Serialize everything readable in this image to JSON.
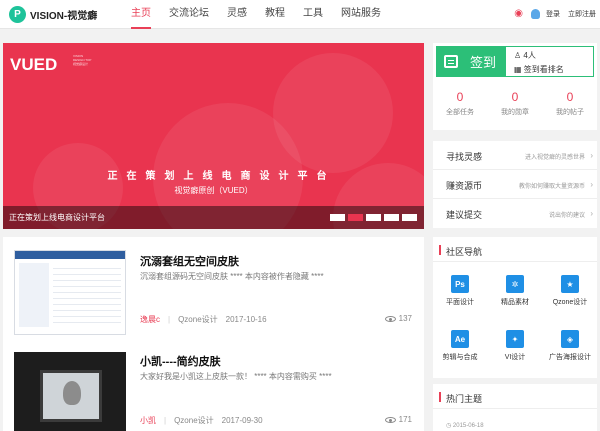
{
  "header": {
    "logo_letter": "P",
    "logo_text": "VISION-视觉癖",
    "nav": [
      "主页",
      "交流论坛",
      "灵感",
      "教程",
      "工具",
      "网站服务"
    ],
    "login": "登录",
    "register": "立即注册"
  },
  "banner": {
    "logo": "VUED",
    "logo_sub_1": "VISION",
    "logo_sub_2": "DESIGN TOP",
    "logo_sub_3": "视觉癖设计",
    "headline": "正在策划上线电商设计平台",
    "sub": "视觉癖原创（VUED）",
    "caption": "正在策划上线电商设计平台",
    "slide_count": 5,
    "active_slide": 2
  },
  "articles": [
    {
      "title": "沉溺套组无空间皮肤",
      "desc": "沉溺套组源码无空间皮肤 **** 本内容被作者隐藏 ****",
      "author": "逸晨c",
      "category": "Qzone设计",
      "date": "2017-10-16",
      "views": "137"
    },
    {
      "title": "小凯----简约皮肤",
      "desc": "大家好我是小凯这上皮肤一款！ **** 本内容需购买 ****",
      "author": "小凯",
      "category": "Qzone设计",
      "date": "2017-09-30",
      "views": "171"
    }
  ],
  "sidebar": {
    "sign": {
      "label": "签到",
      "count": "4人",
      "rank": "签到看排名"
    },
    "stats": [
      {
        "num": "0",
        "label": "全部任务"
      },
      {
        "num": "0",
        "label": "我的勋章"
      },
      {
        "num": "0",
        "label": "我的帖子"
      }
    ],
    "links": [
      {
        "title": "寻找灵感",
        "desc": "进入视觉癖的灵感世界"
      },
      {
        "title": "赚资源币",
        "desc": "教你如何赚取大量资源币"
      },
      {
        "title": "建议提交",
        "desc": "说出你的建议"
      }
    ],
    "community": {
      "title": "社区导航",
      "items": [
        {
          "icon_text": "Ps",
          "label": "平面设计",
          "color": "#1f8fe5"
        },
        {
          "icon_text": "✲",
          "label": "精品素材",
          "color": "#1f8fe5"
        },
        {
          "icon_text": "★",
          "label": "Qzone设计",
          "color": "#1f8fe5"
        },
        {
          "icon_text": "Ae",
          "label": "剪辑与合成",
          "color": "#1f8fe5"
        },
        {
          "icon_text": "✦",
          "label": "VI设计",
          "color": "#1f8fe5"
        },
        {
          "icon_text": "◈",
          "label": "广告海报设计",
          "color": "#1f8fe5"
        }
      ]
    },
    "hot": {
      "title": "热门主题",
      "first_date": "2015-06-18"
    }
  },
  "colors": {
    "accent": "#e94057",
    "sign_green": "#2cbf78",
    "banner_red": "#e9344f",
    "logo_teal": "#1ec39a"
  }
}
